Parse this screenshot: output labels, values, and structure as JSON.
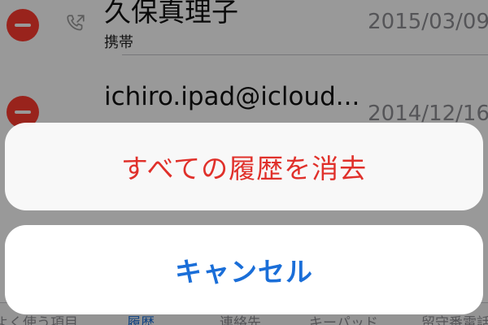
{
  "recents": [
    {
      "name": "久保真理子",
      "type": "携帯",
      "date": "2015/03/09",
      "delete_icon": "minus-circle-icon",
      "call_icon": "phone-outgoing-icon"
    },
    {
      "name": "ichiro.ipad@icloud...",
      "date": "2014/12/16",
      "delete_icon": "minus-circle-icon"
    }
  ],
  "action_sheet": {
    "destructive_label": "すべての履歴を消去",
    "cancel_label": "キャンセル"
  },
  "tab_bar": {
    "favorites": "よく使う項目",
    "recents": "履歴",
    "contacts": "連絡先",
    "keypad": "キーパッド",
    "voicemail": "留守番電話"
  },
  "colors": {
    "destructive": "#e0302a",
    "accent": "#1a6ed8",
    "delete_red": "#ff3b30",
    "secondary_text": "#8e8e93"
  }
}
